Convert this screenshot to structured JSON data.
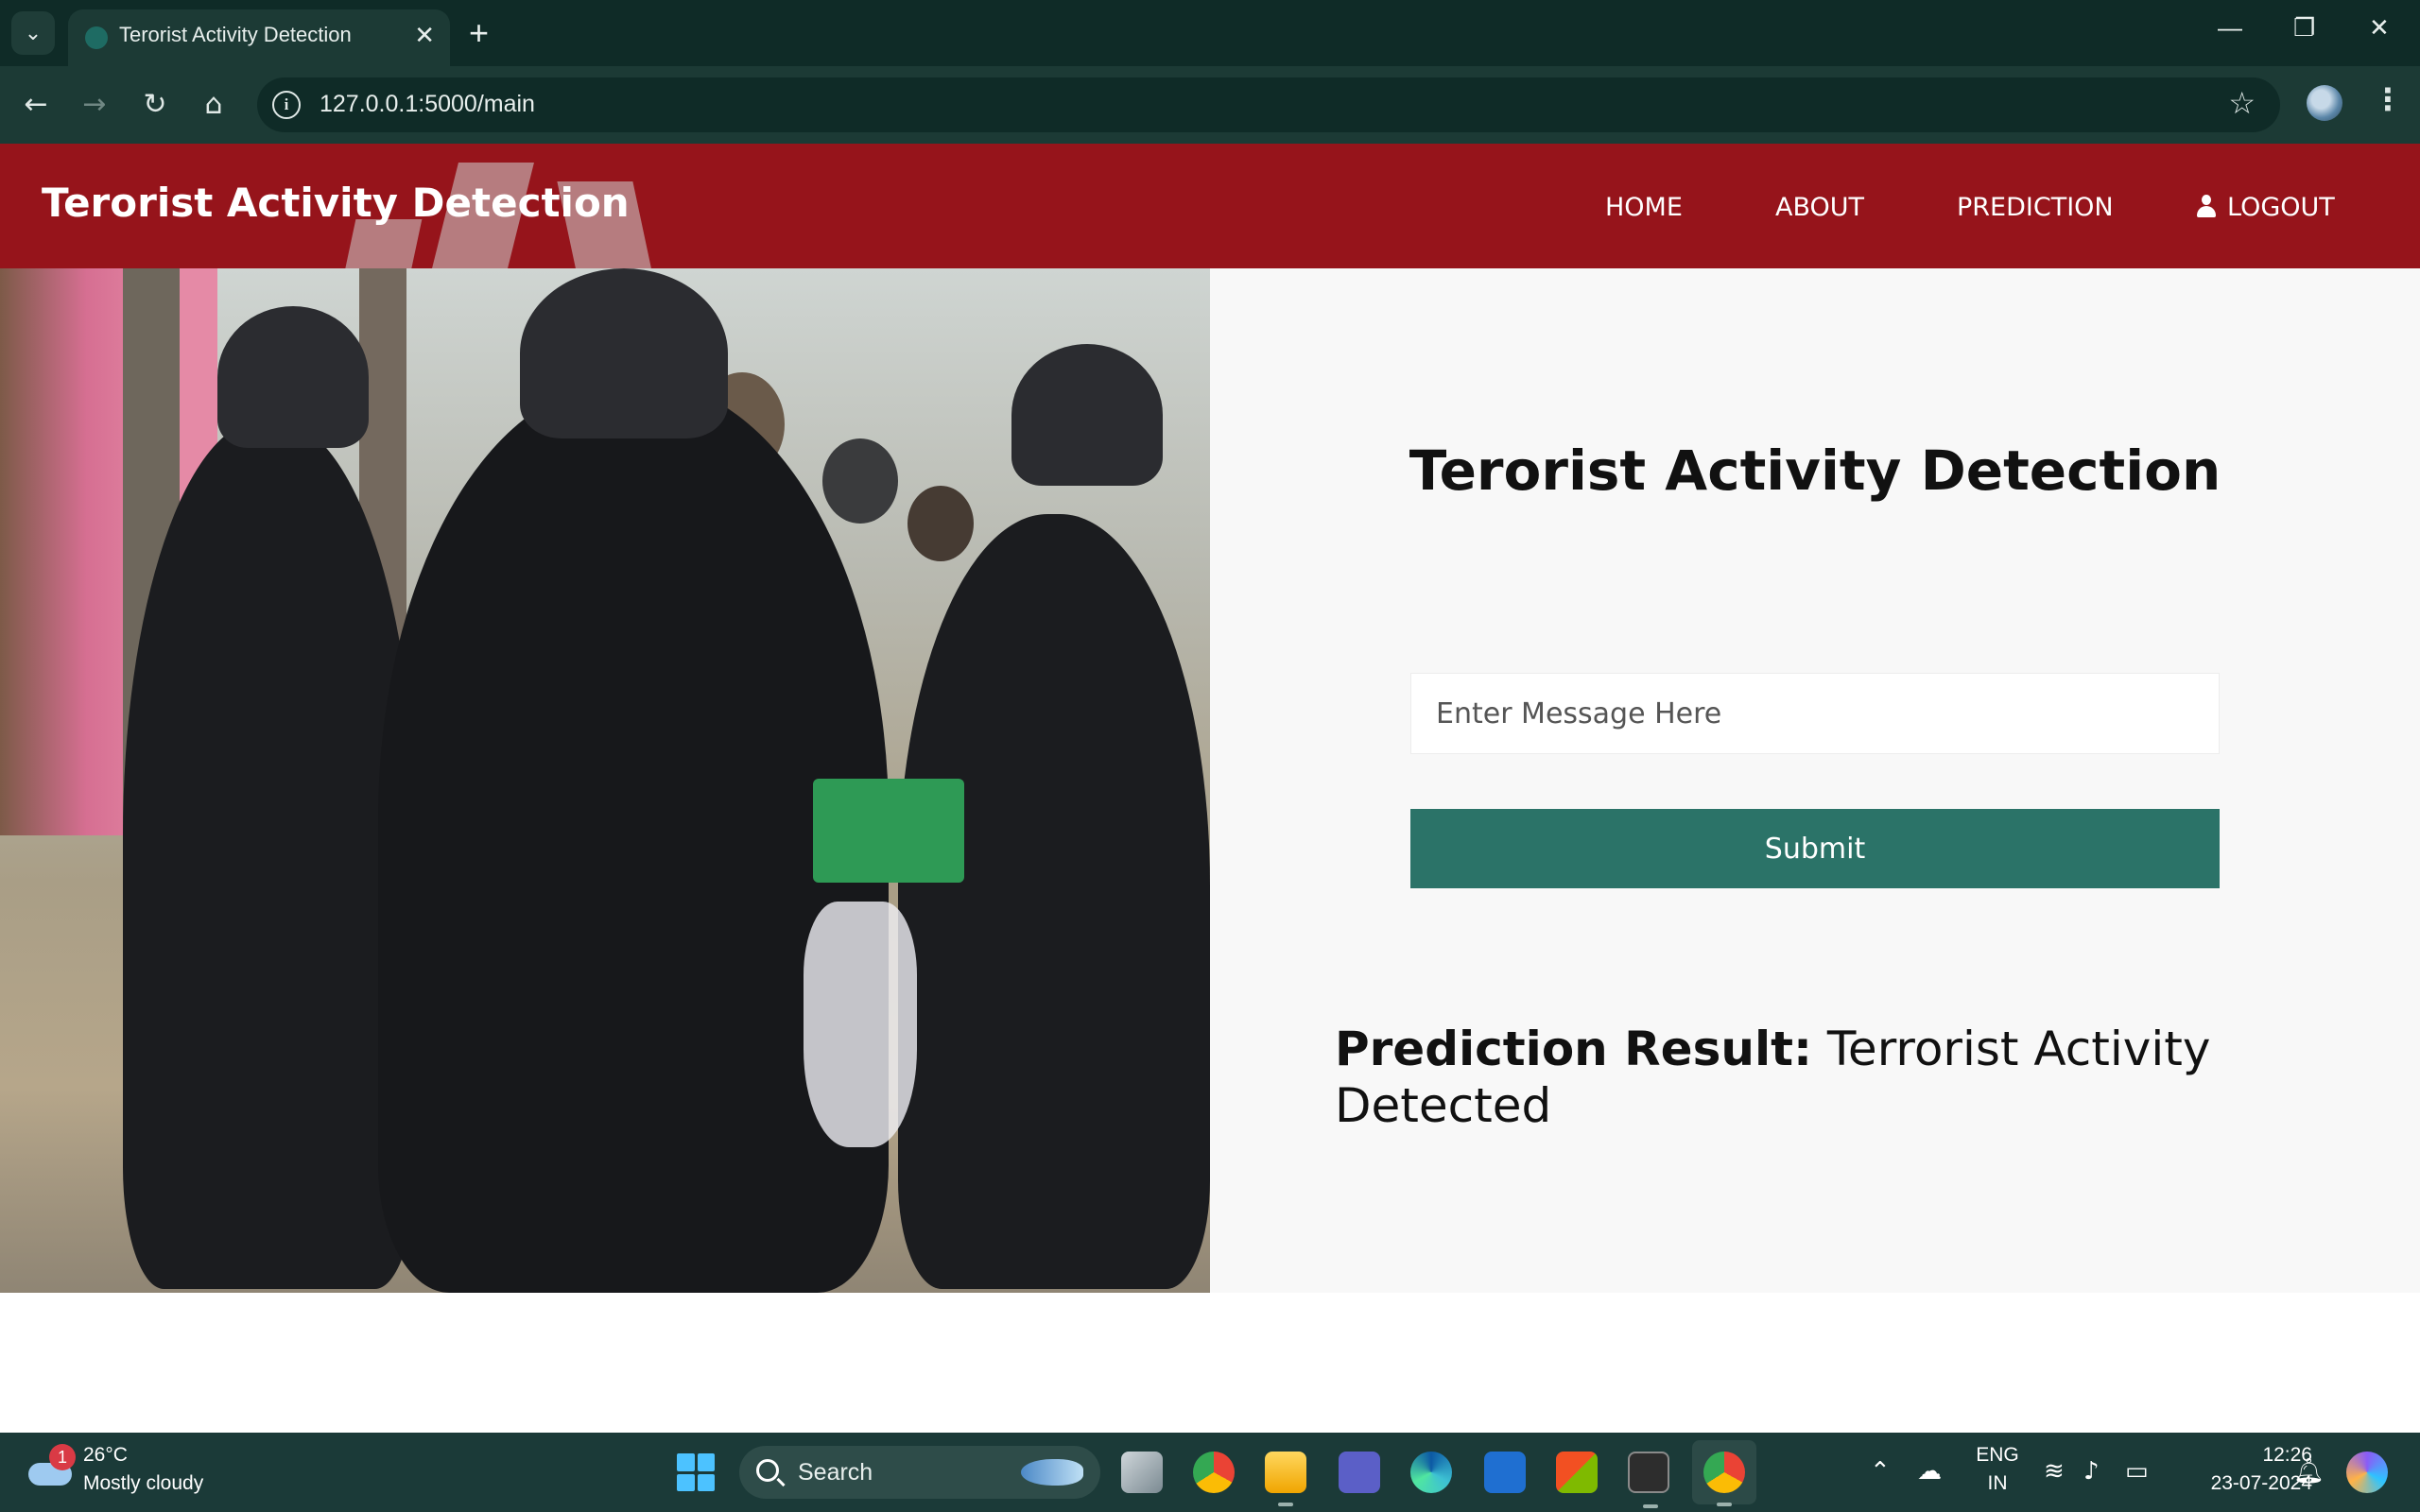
{
  "browser": {
    "tab_title": "Terorist Activity Detection",
    "tab_close": "✕",
    "new_tab": "+",
    "url": "127.0.0.1:5000/main"
  },
  "site": {
    "brand": "Terorist Activity Detection",
    "nav": {
      "home": "HOME",
      "about": "ABOUT",
      "prediction": "PREDICTION",
      "logout": "LOGOUT"
    }
  },
  "form": {
    "title": "Terorist Activity Detection",
    "message_placeholder": "Enter Message Here",
    "message_value": "",
    "submit_label": "Submit"
  },
  "result": {
    "label": "Prediction Result:",
    "value": "Terrorist Activity Detected"
  },
  "taskbar": {
    "weather_badge": "1",
    "temperature": "26°C",
    "condition": "Mostly cloudy",
    "search_label": "Search",
    "language_line1": "ENG",
    "language_line2": "IN",
    "time": "12:26",
    "date": "23-07-2024"
  },
  "colors": {
    "header_red": "#96141b",
    "submit_teal": "#2b7368",
    "browser_chrome": "#1c3a35",
    "taskbar": "#1b3a38"
  }
}
